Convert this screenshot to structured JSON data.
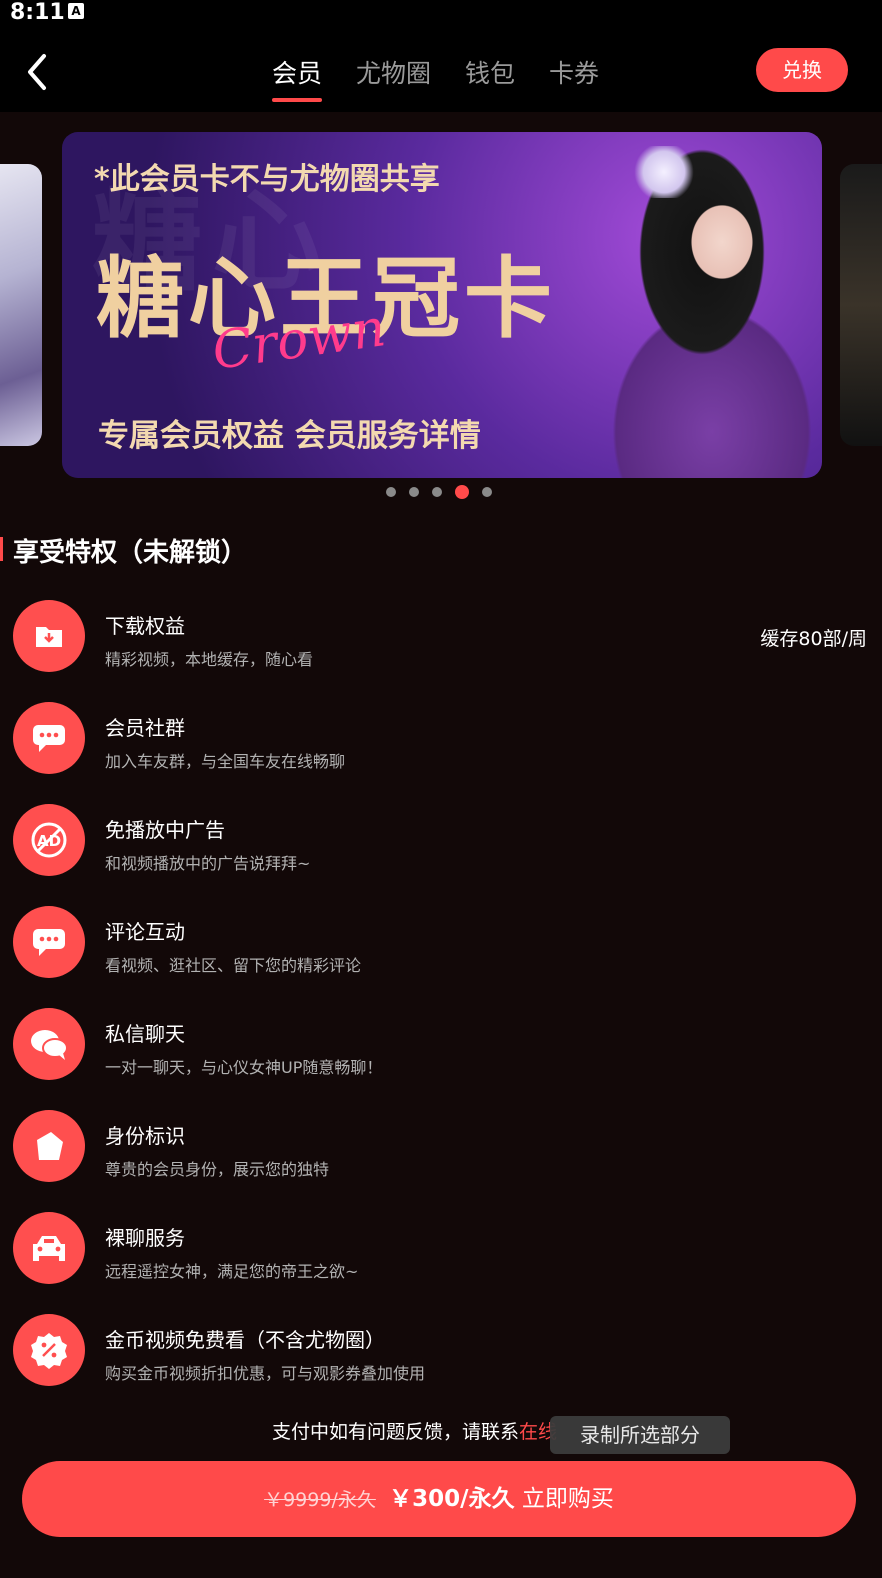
{
  "status": {
    "time": "8:11",
    "indicator": "A"
  },
  "nav": {
    "back_icon": "chevron-left-icon",
    "tabs": [
      {
        "label": "会员",
        "active": true
      },
      {
        "label": "尤物圈",
        "active": false
      },
      {
        "label": "钱包",
        "active": false
      },
      {
        "label": "卡券",
        "active": false
      }
    ],
    "redeem_label": "兑换"
  },
  "banner": {
    "note": "*此会员卡不与尤物圈共享",
    "title": "糖心王冠卡",
    "crown_script": "Crown",
    "subtitle": "专属会员权益  会员服务详情",
    "dots_total": 5,
    "active_dot": 4
  },
  "section": {
    "title": "享受特权（未解锁）"
  },
  "privileges": [
    {
      "title": "下载权益",
      "desc": "精彩视频，本地缓存，随心看",
      "right": "缓存80部/周",
      "icon": "download-folder-icon"
    },
    {
      "title": "会员社群",
      "desc": "加入车友群，与全国车友在线畅聊",
      "right": "",
      "icon": "chat-bubble-icon"
    },
    {
      "title": "免播放中广告",
      "desc": "和视频播放中的广告说拜拜~",
      "right": "",
      "icon": "no-ad-icon"
    },
    {
      "title": "评论互动",
      "desc": "看视频、逛社区、留下您的精彩评论",
      "right": "",
      "icon": "comment-icon"
    },
    {
      "title": "私信聊天",
      "desc": "一对一聊天，与心仪女神UP随意畅聊！",
      "right": "",
      "icon": "message-icon"
    },
    {
      "title": "身份标识",
      "desc": "尊贵的会员身份，展示您的独特",
      "right": "",
      "icon": "badge-icon"
    },
    {
      "title": "裸聊服务",
      "desc": "远程遥控女神，满足您的帝王之欲~",
      "right": "",
      "icon": "car-icon"
    },
    {
      "title": "金币视频免费看（不含尤物圈）",
      "desc": "购买金币视频折扣优惠，可与观影券叠加使用",
      "right": "",
      "icon": "discount-icon"
    }
  ],
  "footer": {
    "note": "支付中如有问题反馈，请联系",
    "note_link": "在线",
    "recording_overlay": "录制所选部分",
    "old_price": "￥9999/永久",
    "price": "￥300/永久",
    "buy_label": "立即购买"
  },
  "colors": {
    "accent": "#ff4a4a",
    "background": "#120808"
  }
}
